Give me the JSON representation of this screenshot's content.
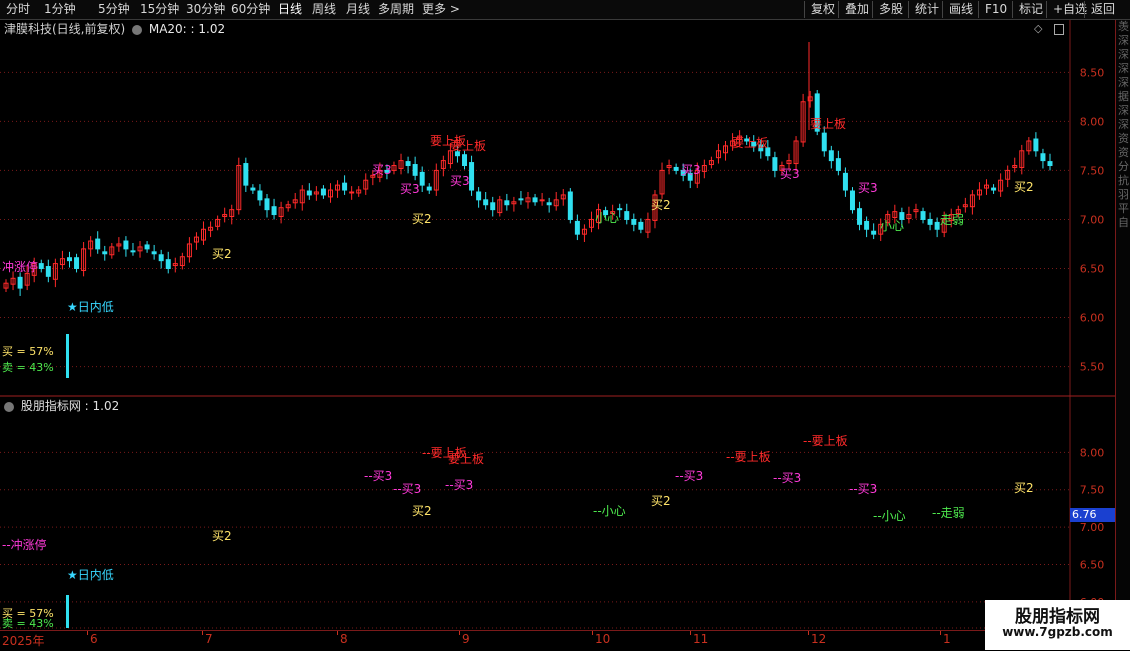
{
  "toolbar": {
    "left_items": [
      "分时",
      "1分钟",
      "5分钟",
      "15分钟",
      "30分钟",
      "60分钟",
      "日线",
      "周线",
      "月线",
      "多周期",
      "更多 >"
    ],
    "active_item": "日线",
    "right_items": [
      "复权",
      "叠加",
      "多股",
      "统计",
      "画线",
      "F10",
      "标记",
      "+自选",
      "返回"
    ]
  },
  "main_panel": {
    "stock_title": "津膜科技(日线,前复权)",
    "indicator": "MA20: : 1.02"
  },
  "sub_panel": {
    "title": "股朋指标网 : 1.02"
  },
  "price_axis_main": [
    "8.50",
    "8.00",
    "7.50",
    "7.00",
    "6.50",
    "6.00",
    "5.50"
  ],
  "price_axis_sub": [
    "8.00",
    "7.50",
    "7.00",
    "6.50",
    "6.00"
  ],
  "current_price_tag": "6.76",
  "dates": [
    "2025年",
    "6",
    "7",
    "8",
    "9",
    "10",
    "11",
    "12",
    "1"
  ],
  "buy_sell": {
    "buy_label": "买 = 57%",
    "sell_label": "卖 = 43%"
  },
  "signals_main": [
    {
      "text": "冲涨停",
      "color": "#ff3ad9"
    },
    {
      "text": "★日内低",
      "color": "#38d8ff"
    },
    {
      "text": "买2",
      "color": "#ffe46a"
    },
    {
      "text": "买3",
      "color": "#ff3ad9"
    },
    {
      "text": "买3",
      "color": "#ff3ad9"
    },
    {
      "text": "买2",
      "color": "#ffe46a"
    },
    {
      "text": "要上板",
      "color": "#ff2a2a"
    },
    {
      "text": "要上板",
      "color": "#ff2a2a"
    },
    {
      "text": "买3",
      "color": "#ff3ad9"
    },
    {
      "text": "小心",
      "color": "#4eea4e"
    },
    {
      "text": "买2",
      "color": "#ffe46a"
    },
    {
      "text": "买3",
      "color": "#ff3ad9"
    },
    {
      "text": "要上板",
      "color": "#ff2a2a"
    },
    {
      "text": "买3",
      "color": "#ff3ad9"
    },
    {
      "text": "要上板",
      "color": "#ff2a2a"
    },
    {
      "text": "买3",
      "color": "#ff3ad9"
    },
    {
      "text": "小心",
      "color": "#4eea4e"
    },
    {
      "text": "走弱",
      "color": "#4eea4e"
    },
    {
      "text": "买2",
      "color": "#ffe46a"
    }
  ],
  "signals_sub": [
    {
      "text": "--冲涨停",
      "color": "#ff3ad9"
    },
    {
      "text": "★日内低",
      "color": "#38d8ff"
    },
    {
      "text": "买2",
      "color": "#ffe46a"
    },
    {
      "text": "--买3",
      "color": "#ff3ad9"
    },
    {
      "text": "--买3",
      "color": "#ff3ad9"
    },
    {
      "text": "买2",
      "color": "#ffe46a"
    },
    {
      "text": "--要上板",
      "color": "#ff2a2a"
    },
    {
      "text": "要上板",
      "color": "#ff2a2a"
    },
    {
      "text": "--买3",
      "color": "#ff3ad9"
    },
    {
      "text": "--小心",
      "color": "#4eea4e"
    },
    {
      "text": "买2",
      "color": "#ffe46a"
    },
    {
      "text": "--买3",
      "color": "#ff3ad9"
    },
    {
      "text": "--要上板",
      "color": "#ff2a2a"
    },
    {
      "text": "--买3",
      "color": "#ff3ad9"
    },
    {
      "text": "--要上板",
      "color": "#ff2a2a"
    },
    {
      "text": "--买3",
      "color": "#ff3ad9"
    },
    {
      "text": "--小心",
      "color": "#4eea4e"
    },
    {
      "text": "--走弱",
      "color": "#4eea4e"
    },
    {
      "text": "买2",
      "color": "#ffe46a"
    }
  ],
  "watermark": {
    "title": "股朋指标网",
    "url": "www.7gpzb.com"
  },
  "side_strip_chars": [
    "羡",
    "深",
    "深",
    "深",
    "深",
    "据",
    "深",
    "深",
    "资",
    "资",
    "分",
    "抗",
    "羽",
    "平",
    "自"
  ],
  "colors": {
    "up": "#ff2a2a",
    "down": "#30e0f0",
    "grid": "#7a1a1a",
    "axis": "#c8301f"
  }
}
